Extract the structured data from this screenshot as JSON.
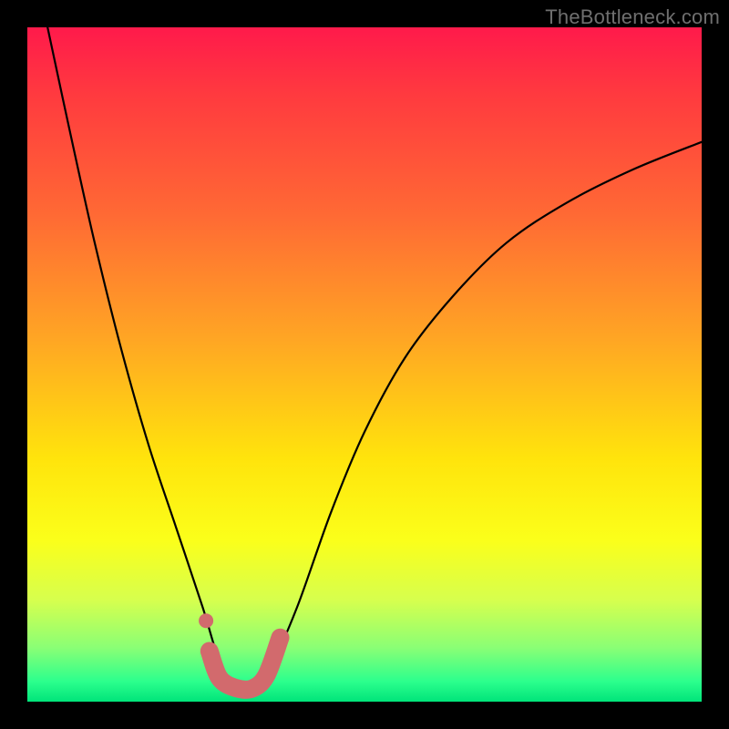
{
  "watermark": "TheBottleneck.com",
  "chart_data": {
    "type": "line",
    "title": "",
    "xlabel": "",
    "ylabel": "",
    "xlim": [
      0,
      1
    ],
    "ylim": [
      0,
      1
    ],
    "series": [
      {
        "name": "bottleneck-curve",
        "x": [
          0.03,
          0.06,
          0.1,
          0.14,
          0.18,
          0.22,
          0.26,
          0.285,
          0.31,
          0.335,
          0.36,
          0.4,
          0.45,
          0.5,
          0.56,
          0.63,
          0.71,
          0.8,
          0.9,
          1.0
        ],
        "y": [
          1.0,
          0.86,
          0.68,
          0.52,
          0.38,
          0.26,
          0.14,
          0.06,
          0.02,
          0.02,
          0.05,
          0.14,
          0.28,
          0.4,
          0.51,
          0.6,
          0.68,
          0.74,
          0.79,
          0.83
        ]
      }
    ],
    "highlight": {
      "name": "minimum-band",
      "x": [
        0.27,
        0.285,
        0.31,
        0.335,
        0.355,
        0.375
      ],
      "y": [
        0.075,
        0.035,
        0.02,
        0.02,
        0.04,
        0.095
      ]
    },
    "marker": {
      "x": 0.265,
      "y": 0.12
    }
  },
  "colors": {
    "curve": "#000000",
    "highlight": "#d26a6d",
    "gradient_top": "#ff1a4b",
    "gradient_bottom": "#00e47a"
  }
}
